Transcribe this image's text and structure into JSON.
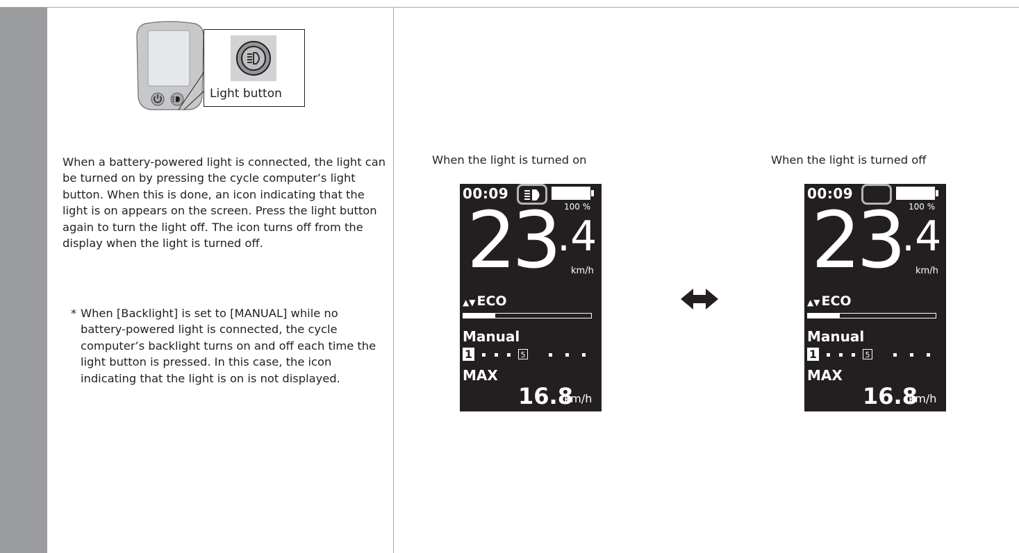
{
  "device_callout": {
    "label": "Light button"
  },
  "description": {
    "paragraph": "When a battery-powered light is connected, the light can be turned on by pressing the cycle computer’s light button. When this is done, an icon indicating that the light is on appears on the screen. Press the light button again to turn the light off. The icon turns off from the display when the light is turned off.",
    "note_marker": "*",
    "note": "When [Backlight] is set to [MANUAL] while no battery-powered light is connected, the cycle computer’s backlight turns on and off each time the light button is pressed. In this case, the icon indicating that the light is on is not displayed."
  },
  "captions": {
    "on": "When the light is turned on",
    "off": "When the light is turned off"
  },
  "screen": {
    "time": "00:09",
    "battery_pct": "100 %",
    "battery_level": 1.0,
    "speed_int": "23",
    "speed_dec": ".4",
    "speed_unit": "km/h",
    "mode_arrows": "▲▼",
    "mode": "ECO",
    "assist_level": 0.25,
    "shift_mode": "Manual",
    "gear_current": "1",
    "gear_marker": "5",
    "max_label": "MAX",
    "max_value": "16.8",
    "max_unit": "km/h"
  },
  "icons": {
    "light_on": "headlight-icon",
    "swap": "double-arrow-icon",
    "power": "power-icon"
  },
  "colors": {
    "screen_bg": "#231f20",
    "sidebar": "#9b9c9e",
    "highlight_frame": "#b3b4b6"
  }
}
